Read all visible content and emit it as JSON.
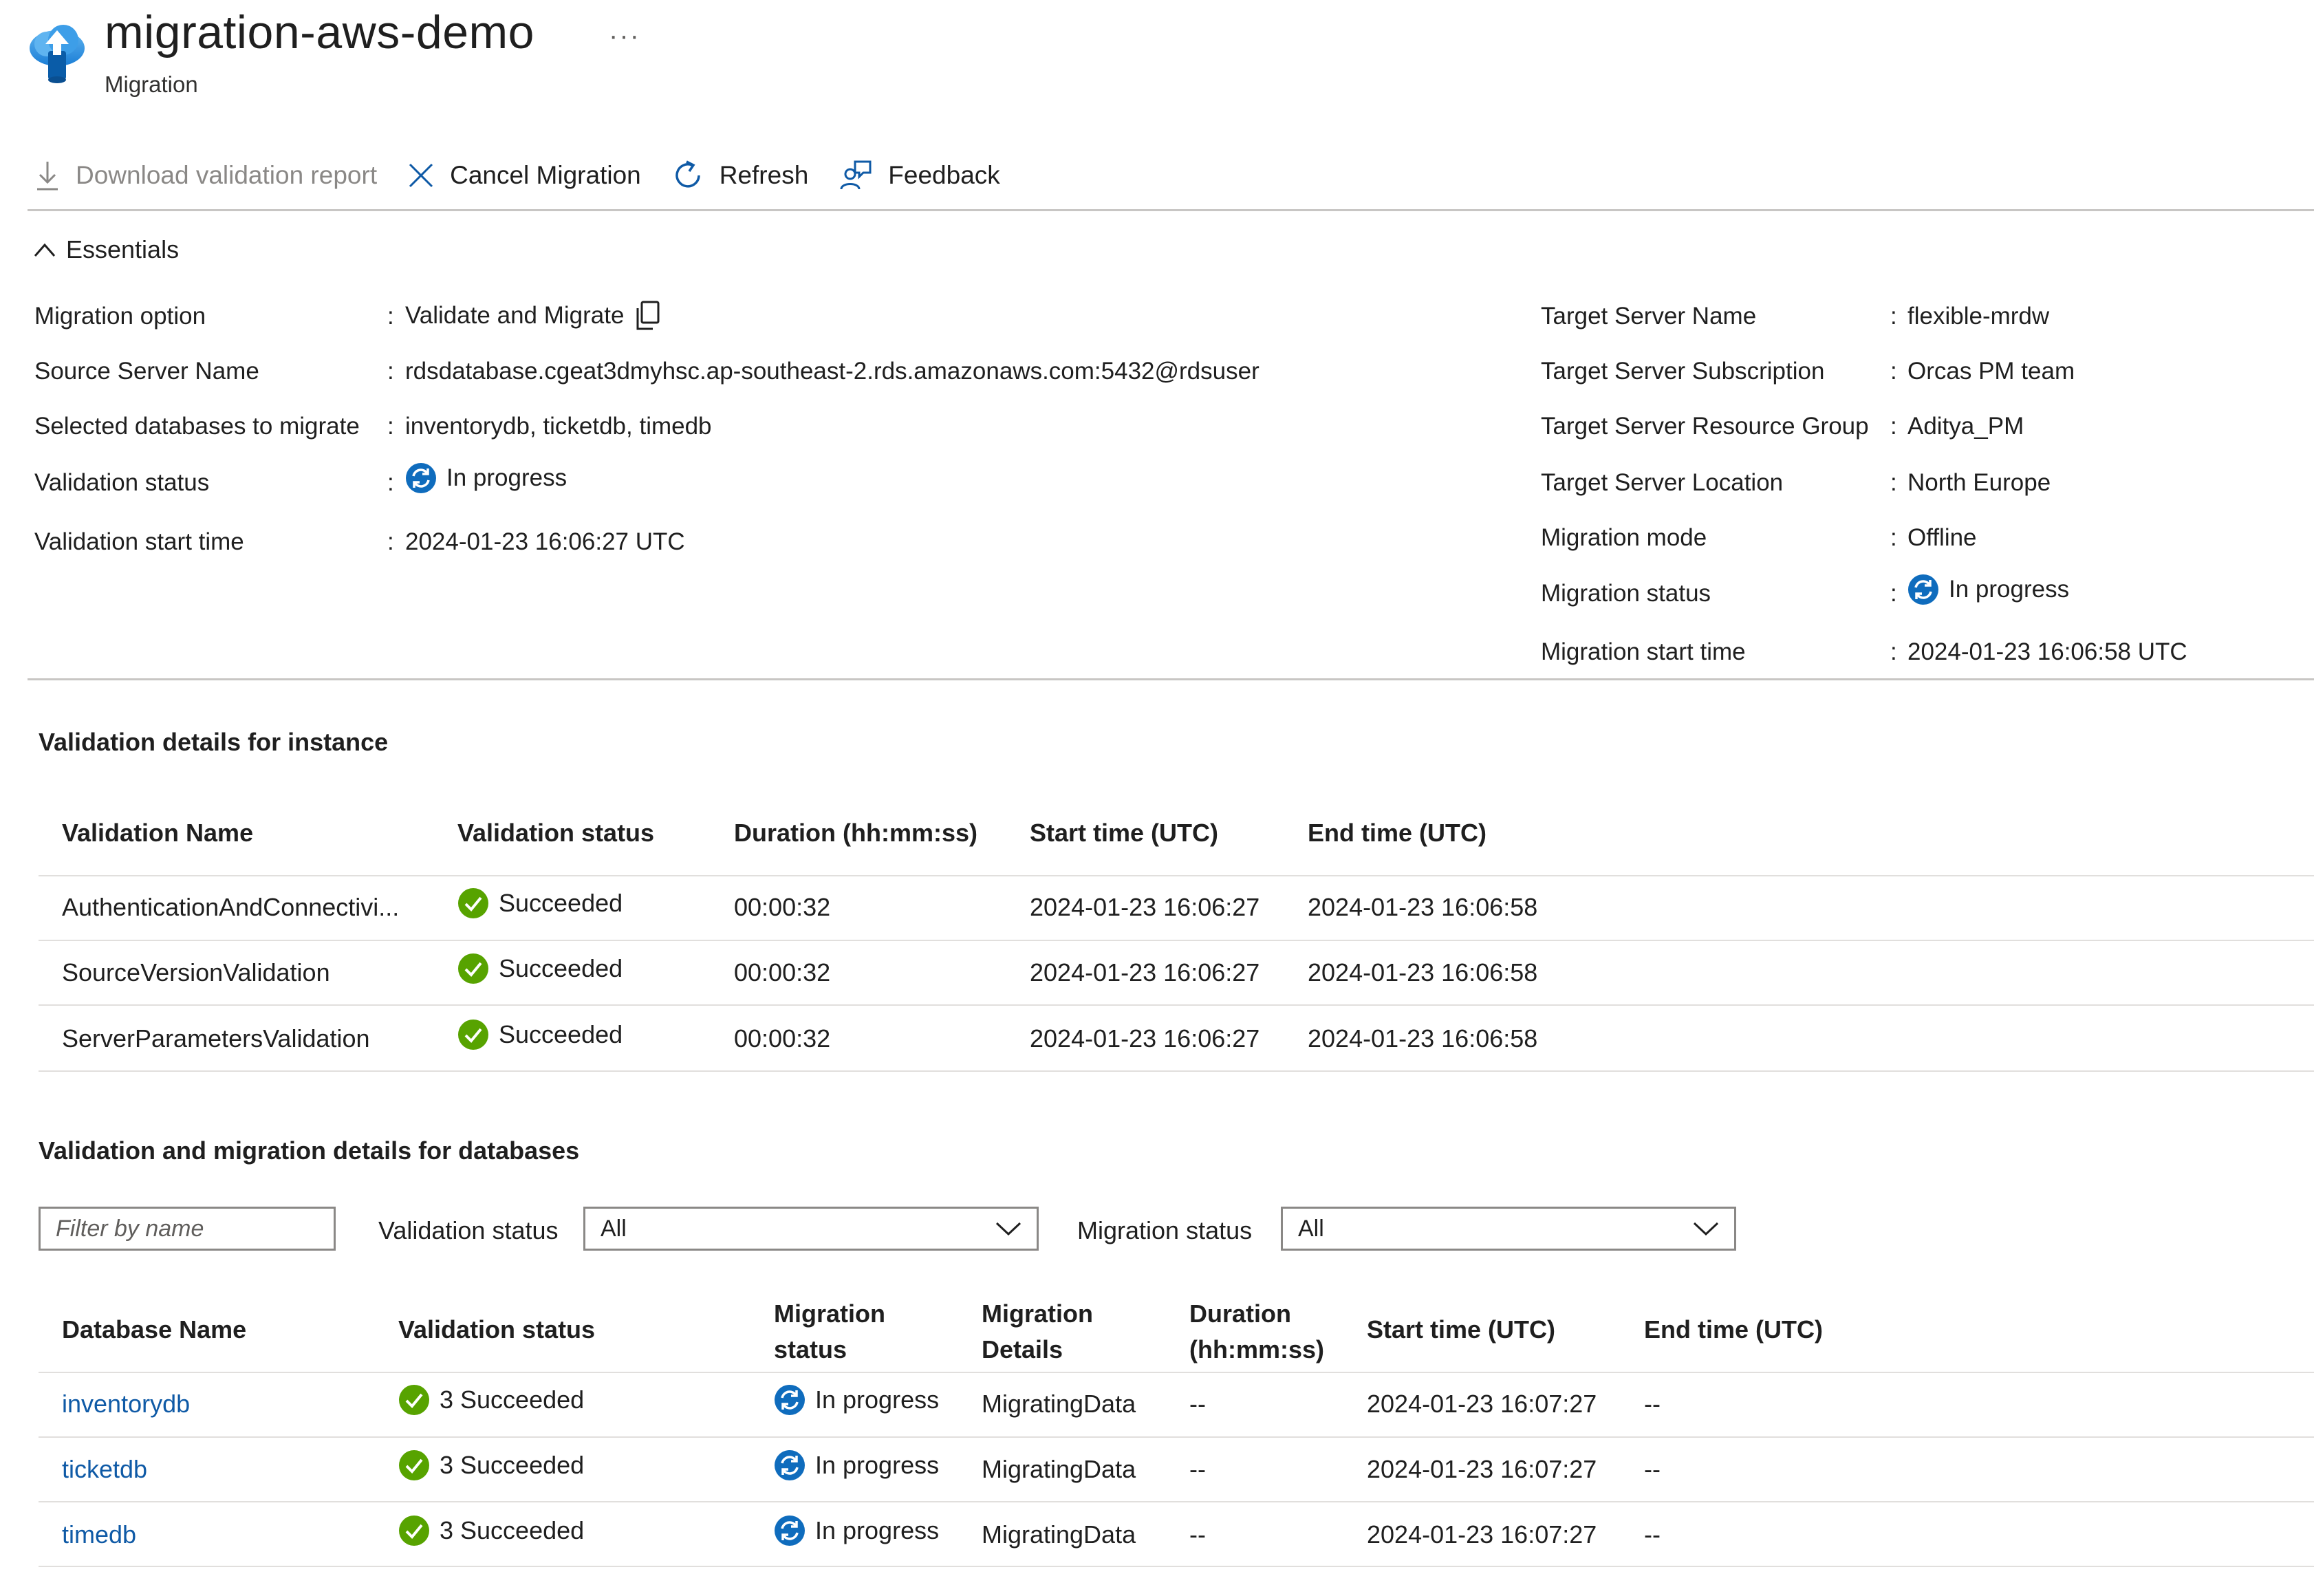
{
  "header": {
    "title": "migration-aws-demo",
    "subtitle": "Migration",
    "more": "···"
  },
  "toolbar": {
    "download": "Download validation report",
    "cancel": "Cancel Migration",
    "refresh": "Refresh",
    "feedback": "Feedback"
  },
  "essentials": {
    "heading": "Essentials",
    "sep": ":",
    "left": [
      {
        "label": "Migration option",
        "value": "Validate and Migrate"
      },
      {
        "label": "Source Server Name",
        "value": "rdsdatabase.cgeat3dmyhsc.ap-southeast-2.rds.amazonaws.com:5432@rdsuser"
      },
      {
        "label": "Selected databases to migrate",
        "value": "inventorydb, ticketdb, timedb"
      },
      {
        "label": "Validation status",
        "value": "In progress"
      },
      {
        "label": "Validation start time",
        "value": "2024-01-23 16:06:27 UTC"
      }
    ],
    "right": [
      {
        "label": "Target Server Name",
        "value": "flexible-mrdw"
      },
      {
        "label": "Target Server Subscription",
        "value": "Orcas PM team"
      },
      {
        "label": "Target Server Resource Group",
        "value": "Aditya_PM"
      },
      {
        "label": "Target Server Location",
        "value": "North Europe"
      },
      {
        "label": "Migration mode",
        "value": "Offline"
      },
      {
        "label": "Migration status",
        "value": "In progress"
      },
      {
        "label": "Migration start time",
        "value": "2024-01-23 16:06:58 UTC"
      }
    ]
  },
  "instance": {
    "title": "Validation details for instance",
    "headers": [
      "Validation Name",
      "Validation status",
      "Duration (hh:mm:ss)",
      "Start time (UTC)",
      "End time (UTC)"
    ],
    "rows": [
      {
        "name": "AuthenticationAndConnectivi...",
        "status": "Succeeded",
        "duration": "00:00:32",
        "start": "2024-01-23 16:06:27",
        "end": "2024-01-23 16:06:58"
      },
      {
        "name": "SourceVersionValidation",
        "status": "Succeeded",
        "duration": "00:00:32",
        "start": "2024-01-23 16:06:27",
        "end": "2024-01-23 16:06:58"
      },
      {
        "name": "ServerParametersValidation",
        "status": "Succeeded",
        "duration": "00:00:32",
        "start": "2024-01-23 16:06:27",
        "end": "2024-01-23 16:06:58"
      }
    ]
  },
  "databases": {
    "title": "Validation and migration details for databases",
    "filter_placeholder": "Filter by name",
    "validation_filter_label": "Validation status",
    "validation_filter_value": "All",
    "migration_filter_label": "Migration status",
    "migration_filter_value": "All",
    "headers": {
      "name": "Database Name",
      "validation": "Validation status",
      "migration_1": "Migration",
      "migration_2": "status",
      "details_1": "Migration",
      "details_2": "Details",
      "duration_1": "Duration",
      "duration_2": "(hh:mm:ss)",
      "start": "Start time (UTC)",
      "end": "End time (UTC)"
    },
    "rows": [
      {
        "name": "inventorydb",
        "validation": "3 Succeeded",
        "migration": "In progress",
        "details": "MigratingData",
        "duration": "--",
        "start": "2024-01-23 16:07:27",
        "end": "--"
      },
      {
        "name": "ticketdb",
        "validation": "3 Succeeded",
        "migration": "In progress",
        "details": "MigratingData",
        "duration": "--",
        "start": "2024-01-23 16:07:27",
        "end": "--"
      },
      {
        "name": "timedb",
        "validation": "3 Succeeded",
        "migration": "In progress",
        "details": "MigratingData",
        "duration": "--",
        "start": "2024-01-23 16:07:27",
        "end": "--"
      }
    ]
  },
  "colors": {
    "accent": "#0f5aa6",
    "success": "#57a300",
    "progress": "#0f6cbd"
  },
  "icons": {
    "logo": "migration-cloud-icon",
    "download": "download-icon",
    "cancel": "close-icon",
    "refresh": "refresh-icon",
    "feedback": "feedback-icon",
    "copy": "copy-icon",
    "success": "check-circle-icon",
    "progress": "sync-icon"
  }
}
